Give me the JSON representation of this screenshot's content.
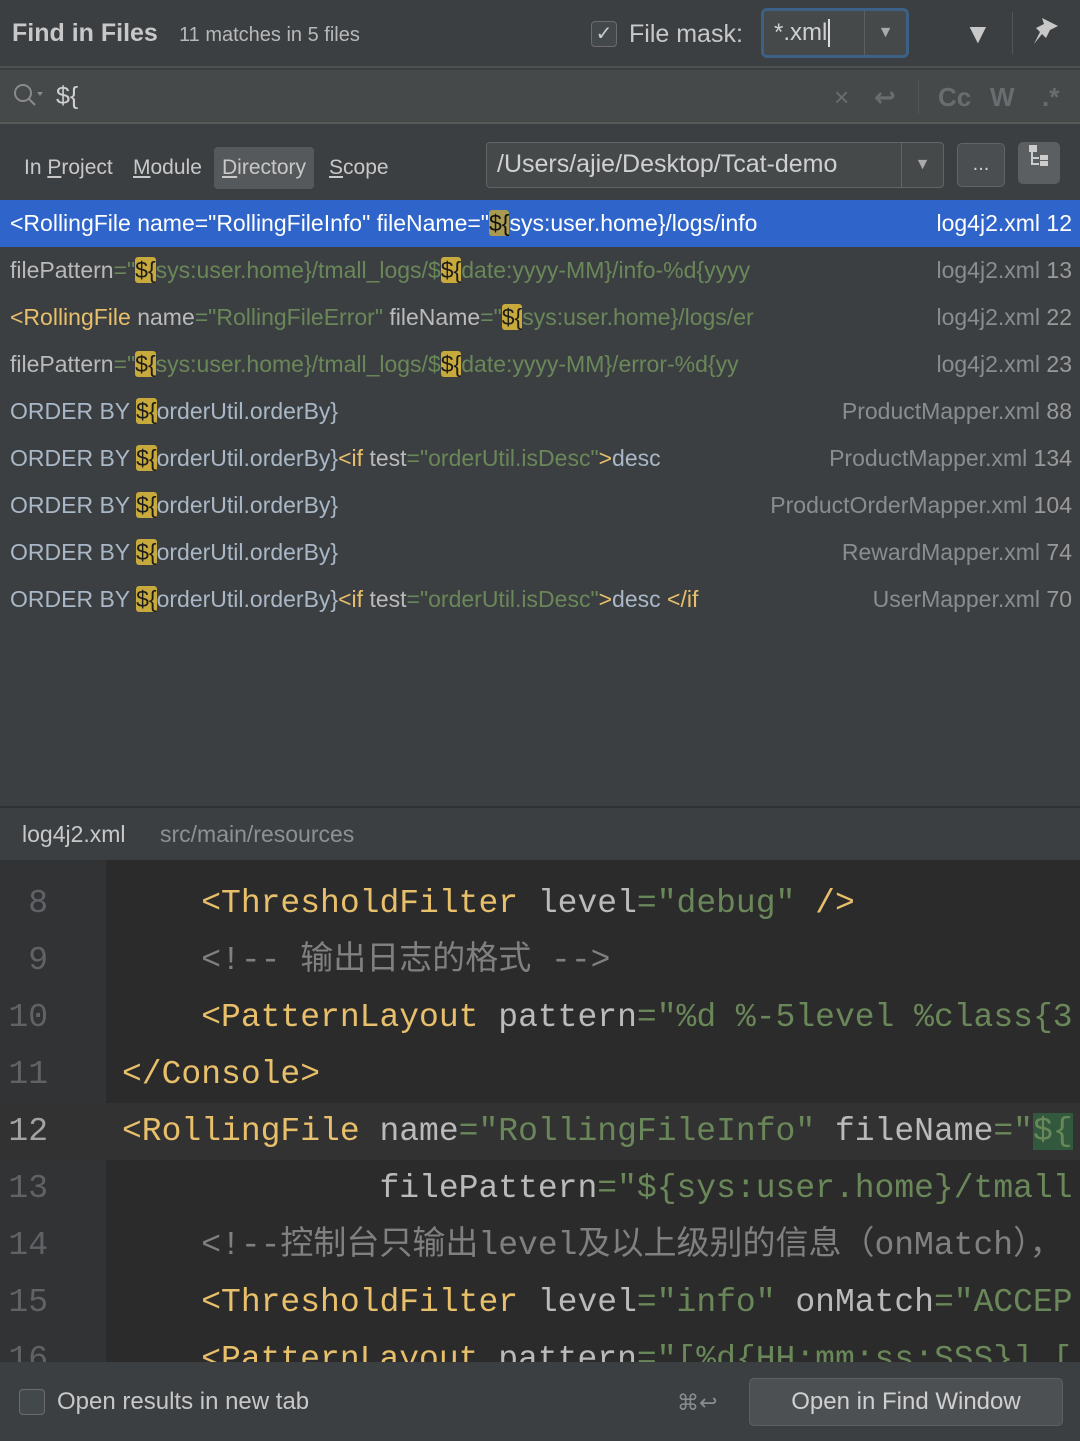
{
  "header": {
    "title": "Find in Files",
    "match_count": "11 matches in 5 files",
    "file_mask_checked": true,
    "file_mask_check_glyph": "✓",
    "file_mask_label": "File mask:",
    "file_mask_value": "*.xml",
    "dropdown_glyph": "▼",
    "filter_icon": "▼",
    "pin_icon": "📌"
  },
  "search": {
    "icon": "⚲",
    "query": "${",
    "clear_icon": "×",
    "newline_icon": "↩",
    "match_case": "Cc",
    "words": "W",
    "regex": ".*"
  },
  "scope": {
    "tabs": [
      {
        "pre": "In ",
        "u": "P",
        "post": "roject"
      },
      {
        "pre": "",
        "u": "M",
        "post": "odule"
      },
      {
        "pre": "",
        "u": "D",
        "post": "irectory"
      },
      {
        "pre": "",
        "u": "S",
        "post": "cope"
      }
    ],
    "selected_tab": "Directory",
    "directory": "/Users/ajie/Desktop/Tcat-demo",
    "browse_label": "...",
    "tree_icon": "⊞"
  },
  "results": [
    {
      "segments": [
        [
          "<RollingFile name=\"RollingFileInfo\" fileName=\"",
          "plain"
        ],
        [
          "${",
          "hl"
        ],
        [
          "sys:user.home}/logs/info",
          "plain"
        ]
      ],
      "file": "log4j2.xml",
      "line": "12",
      "selected": true
    },
    {
      "segments": [
        [
          "filePattern",
          "attr"
        ],
        [
          "=\"",
          "str"
        ],
        [
          "${",
          "hl"
        ],
        [
          "sys:user.home}/tmall_logs/$",
          "str"
        ],
        [
          "${",
          "hl"
        ],
        [
          "date:yyyy-MM}/info-%d{yyyy",
          "str"
        ]
      ],
      "file": "log4j2.xml",
      "line": "13"
    },
    {
      "segments": [
        [
          "<RollingFile",
          "tag"
        ],
        [
          " name",
          "attr"
        ],
        [
          "=\"RollingFileError\"",
          "str"
        ],
        [
          " fileName",
          "attr"
        ],
        [
          "=\"",
          "str"
        ],
        [
          "${",
          "hl"
        ],
        [
          "sys:user.home}/logs/er",
          "str"
        ]
      ],
      "file": "log4j2.xml",
      "line": "22"
    },
    {
      "segments": [
        [
          "filePattern",
          "attr"
        ],
        [
          "=\"",
          "str"
        ],
        [
          "${",
          "hl"
        ],
        [
          "sys:user.home}/tmall_logs/$",
          "str"
        ],
        [
          "${",
          "hl"
        ],
        [
          "date:yyyy-MM}/error-%d{yy",
          "str"
        ]
      ],
      "file": "log4j2.xml",
      "line": "23"
    },
    {
      "segments": [
        [
          "ORDER BY ",
          "plain"
        ],
        [
          "${",
          "hl"
        ],
        [
          "orderUtil.orderBy}",
          "plain"
        ]
      ],
      "file": "ProductMapper.xml",
      "line": "88"
    },
    {
      "segments": [
        [
          "ORDER BY ",
          "plain"
        ],
        [
          "${",
          "hl"
        ],
        [
          "orderUtil.orderBy}",
          "plain"
        ],
        [
          "<if",
          "tag"
        ],
        [
          " test",
          "attr"
        ],
        [
          "=\"orderUtil.isDesc\"",
          "str"
        ],
        [
          ">",
          "tag"
        ],
        [
          "desc",
          "plain"
        ]
      ],
      "file": "ProductMapper.xml",
      "line": "134"
    },
    {
      "segments": [
        [
          "ORDER BY ",
          "plain"
        ],
        [
          "${",
          "hl"
        ],
        [
          "orderUtil.orderBy}",
          "plain"
        ]
      ],
      "file": "ProductOrderMapper.xml",
      "line": "104"
    },
    {
      "segments": [
        [
          "ORDER BY ",
          "plain"
        ],
        [
          "${",
          "hl"
        ],
        [
          "orderUtil.orderBy}",
          "plain"
        ]
      ],
      "file": "RewardMapper.xml",
      "line": "74"
    },
    {
      "segments": [
        [
          "ORDER BY ",
          "plain"
        ],
        [
          "${",
          "hl"
        ],
        [
          "orderUtil.orderBy}",
          "plain"
        ],
        [
          "<if",
          "tag"
        ],
        [
          " test",
          "attr"
        ],
        [
          "=\"orderUtil.isDesc\"",
          "str"
        ],
        [
          ">",
          "tag"
        ],
        [
          "desc ",
          "plain"
        ],
        [
          "</if",
          "tag"
        ]
      ],
      "file": "UserMapper.xml",
      "line": "70"
    }
  ],
  "preview": {
    "file": "log4j2.xml",
    "path": "src/main/resources",
    "current_line": "12",
    "lines": [
      {
        "n": "8",
        "segments": [
          [
            "    <ThresholdFilter",
            "tag"
          ],
          [
            " level",
            "attr"
          ],
          [
            "=\"debug\"",
            "str"
          ],
          [
            " />",
            "tag"
          ]
        ]
      },
      {
        "n": "9",
        "segments": [
          [
            "    <!-- 输出日志的格式 -->",
            "com"
          ]
        ]
      },
      {
        "n": "10",
        "segments": [
          [
            "    <PatternLayout",
            "tag"
          ],
          [
            " pattern",
            "attr"
          ],
          [
            "=\"%d %-5level %class{3",
            "str"
          ]
        ]
      },
      {
        "n": "11",
        "segments": [
          [
            "</Console>",
            "tag"
          ]
        ]
      },
      {
        "n": "12",
        "segments": [
          [
            "<RollingFile",
            "tag"
          ],
          [
            " name",
            "attr"
          ],
          [
            "=\"RollingFileInfo\"",
            "str"
          ],
          [
            " fileName",
            "attr"
          ],
          [
            "=\"",
            "str"
          ],
          [
            "${",
            "match"
          ]
        ]
      },
      {
        "n": "13",
        "segments": [
          [
            "             filePattern",
            "attr"
          ],
          [
            "=\"${sys:user.home}/tmall",
            "str"
          ]
        ]
      },
      {
        "n": "14",
        "segments": [
          [
            "    <!--控制台只输出level及以上级别的信息（onMatch），",
            "com"
          ]
        ]
      },
      {
        "n": "15",
        "segments": [
          [
            "    <ThresholdFilter",
            "tag"
          ],
          [
            " level",
            "attr"
          ],
          [
            "=\"info\"",
            "str"
          ],
          [
            " onMatch",
            "attr"
          ],
          [
            "=\"ACCEP",
            "str"
          ]
        ]
      },
      {
        "n": "16",
        "segments": [
          [
            "    <PatternLayout",
            "tag"
          ],
          [
            " pattern",
            "attr"
          ],
          [
            "=\"[%d{HH:mm:ss:SSS}] [",
            "str"
          ]
        ]
      }
    ]
  },
  "footer": {
    "open_new_tab_label": "Open results in new tab",
    "open_new_tab_checked": false,
    "shortcut": "⌘↩",
    "open_button": "Open in Find Window"
  },
  "colors": {
    "selection": "#2f65ca",
    "match_highlight": "#c7a93c",
    "focus_border": "#3d6185"
  }
}
